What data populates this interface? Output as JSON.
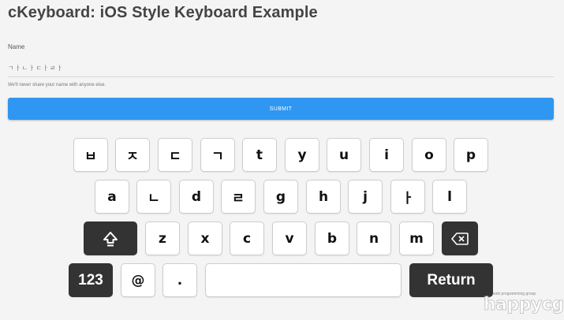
{
  "page": {
    "title": "cKeyboard: iOS Style Keyboard Example"
  },
  "form": {
    "name_label": "Name",
    "name_value": "ㄱㅏㄴㅏㄷㅏㄹㅏ",
    "help_text": "We'll never share your name with anyone else.",
    "submit_label": "SUBMIT"
  },
  "keyboard": {
    "row1": [
      "ㅂ",
      "ㅈ",
      "ㄷ",
      "ㄱ",
      "t",
      "y",
      "u",
      "i",
      "o",
      "p"
    ],
    "row2": [
      "a",
      "ㄴ",
      "d",
      "ㄹ",
      "g",
      "h",
      "j",
      "ㅏ",
      "l"
    ],
    "row3": [
      "z",
      "x",
      "c",
      "v",
      "b",
      "n",
      "m"
    ],
    "numbers_label": "123",
    "at_label": "@",
    "dot_label": ".",
    "return_label": "Return",
    "shift_icon": "shift-icon",
    "backspace_icon": "backspace-icon"
  },
  "watermark": {
    "small": "web programming group",
    "big": "happycgi"
  },
  "colors": {
    "accent": "#2f96f2",
    "dark_key": "#333333",
    "background": "#f4f4f4"
  }
}
